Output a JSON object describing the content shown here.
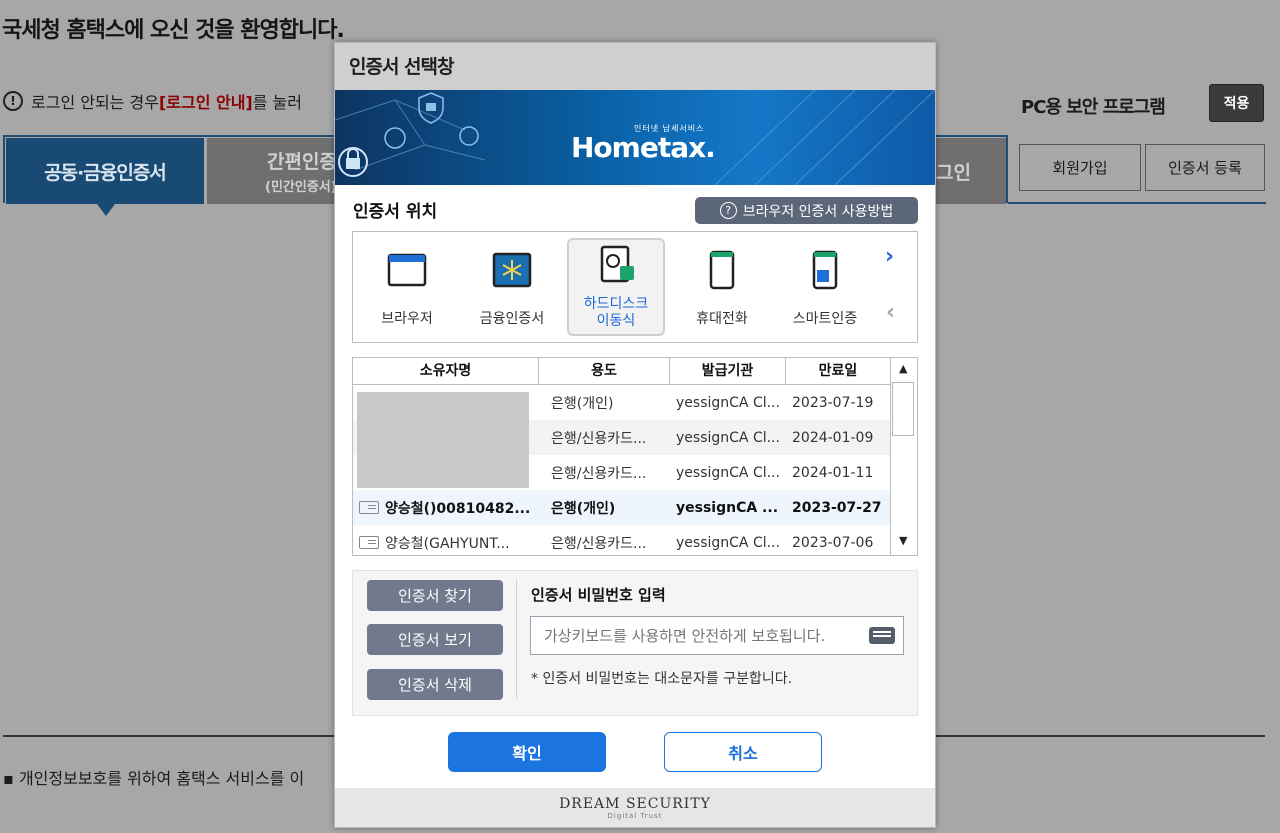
{
  "page": {
    "welcome": "국세청 홈택스에 오신 것을 환영합니다.",
    "notice_prefix": "로그인 안되는 경우 ",
    "notice_link": "[로그인 안내]",
    "notice_suffix": "를 눌러",
    "pc_security": "PC용 보안 프로그램",
    "apply_button": "적용",
    "tabs": [
      {
        "label": "공동·금융인증서"
      },
      {
        "label": "간편인증",
        "sub": "(민간인증서)"
      },
      {
        "label": "그인"
      }
    ],
    "join_button": "회원가입",
    "cert_register_button": "인증서 등록",
    "privacy_text": "개인정보보호를 위하여 홈택스 서비스를 이"
  },
  "dialog": {
    "title": "인증서 선택창",
    "banner": {
      "logo": "Hometax.",
      "logo_sub": "인터넷 납세서비스"
    },
    "location_label": "인증서 위치",
    "guide_button": "브라우저 인증서 사용방법",
    "locations": [
      {
        "label": "브라우저",
        "icon": "browser-icon"
      },
      {
        "label": "금융인증서",
        "icon": "financial-cert-icon"
      },
      {
        "label": "하드디스크 이동식",
        "line1": "하드디스크",
        "line2": "이동식",
        "icon": "harddisk-icon",
        "selected": true
      },
      {
        "label": "휴대전화",
        "icon": "mobile-phone-icon"
      },
      {
        "label": "스마트인증",
        "icon": "smart-cert-icon"
      }
    ],
    "table": {
      "headers": [
        "소유자명",
        "용도",
        "발급기관",
        "만료일"
      ],
      "rows": [
        {
          "owner": "",
          "usage": "은행(개인)",
          "issuer": "yessignCA Cl...",
          "expiry": "2023-07-19"
        },
        {
          "owner": "",
          "usage": "은행/신용카드...",
          "issuer": "yessignCA Cl...",
          "expiry": "2024-01-09"
        },
        {
          "owner": "",
          "usage": "은행/신용카드...",
          "issuer": "yessignCA Cl...",
          "expiry": "2024-01-11"
        },
        {
          "owner": "양승철()00810482...",
          "usage": "은행(개인)",
          "issuer": "yessignCA ...",
          "expiry": "2023-07-27"
        },
        {
          "owner": "양승철(GAHYUNT...",
          "usage": "은행/신용카드...",
          "issuer": "yessignCA Cl...",
          "expiry": "2023-07-06"
        }
      ]
    },
    "side_buttons": [
      "인증서 찾기",
      "인증서 보기",
      "인증서 삭제"
    ],
    "password_label": "인증서 비밀번호 입력",
    "password_placeholder": "가상키보드를 사용하면 안전하게 보호됩니다.",
    "password_note": "* 인증서 비밀번호는 대소문자를 구분합니다.",
    "ok_button": "확인",
    "cancel_button": "취소",
    "footer_brand": "DREAM SECURITY",
    "footer_sub": "Digital Trust"
  }
}
